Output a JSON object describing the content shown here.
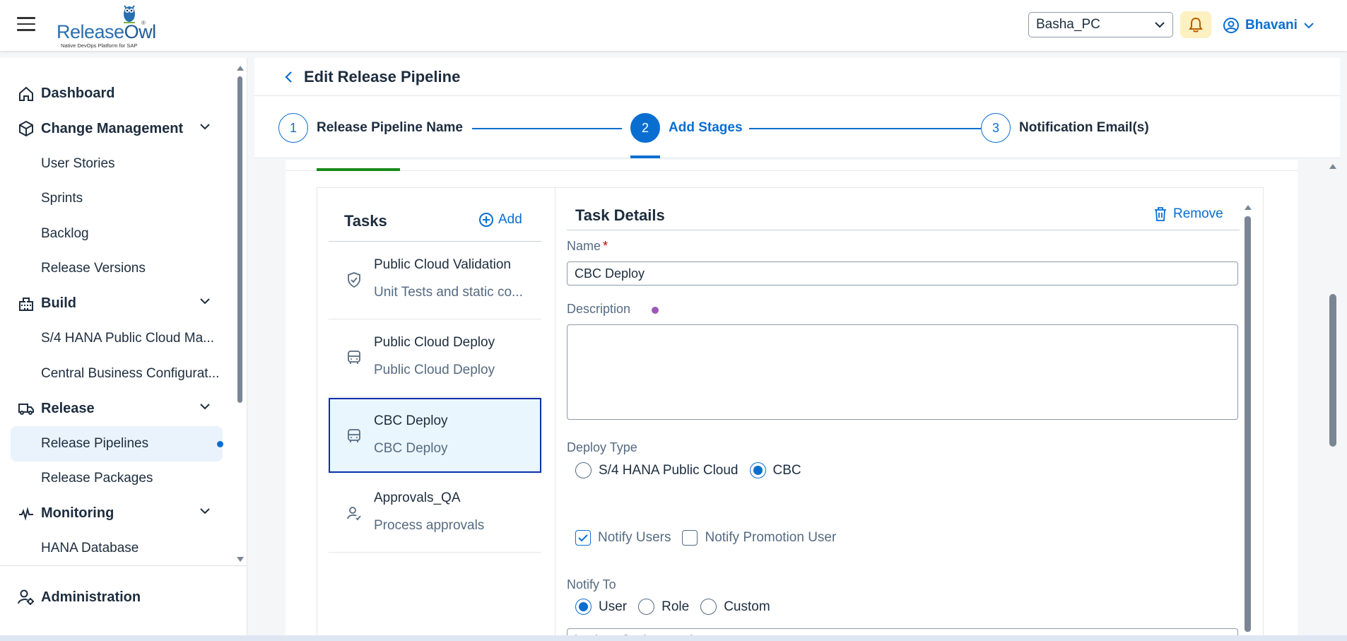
{
  "header": {
    "logo_text_a": "Release",
    "logo_text_b": "Owl",
    "logo_tm": "®",
    "logo_tagline": "Native DevOps Platform for SAP",
    "system_select": "Basha_PC",
    "user_name": "Bhavani"
  },
  "sidebar": {
    "items": [
      {
        "label": "Dashboard",
        "type": "group",
        "icon": "home-icon"
      },
      {
        "label": "Change Management",
        "type": "group",
        "icon": "cube-icon",
        "expanded": true
      },
      {
        "label": "User Stories",
        "type": "sub"
      },
      {
        "label": "Sprints",
        "type": "sub"
      },
      {
        "label": "Backlog",
        "type": "sub"
      },
      {
        "label": "Release Versions",
        "type": "sub"
      },
      {
        "label": "Build",
        "type": "group",
        "icon": "building-icon",
        "expanded": true
      },
      {
        "label": "S/4 HANA Public Cloud Ma...",
        "type": "sub"
      },
      {
        "label": "Central Business Configurat...",
        "type": "sub"
      },
      {
        "label": "Release",
        "type": "group",
        "icon": "truck-icon",
        "expanded": true
      },
      {
        "label": "Release Pipelines",
        "type": "sub",
        "active": true
      },
      {
        "label": "Release Packages",
        "type": "sub"
      },
      {
        "label": "Monitoring",
        "type": "group",
        "icon": "heart-pulse-icon",
        "expanded": true
      },
      {
        "label": "HANA Database",
        "type": "sub"
      }
    ],
    "admin_label": "Administration"
  },
  "page": {
    "title": "Edit Release Pipeline"
  },
  "stepper": {
    "steps": [
      {
        "number": "1",
        "label": "Release Pipeline Name"
      },
      {
        "number": "2",
        "label": "Add Stages",
        "active": true
      },
      {
        "number": "3",
        "label": "Notification Email(s)"
      }
    ]
  },
  "tasks": {
    "title": "Tasks",
    "add_label": "Add",
    "items": [
      {
        "title": "Public Cloud Validation",
        "subtitle": "Unit Tests and static co...",
        "icon": "shield-check-icon"
      },
      {
        "title": "Public Cloud Deploy",
        "subtitle": "Public Cloud Deploy",
        "icon": "bus-icon"
      },
      {
        "title": "CBC Deploy",
        "subtitle": "CBC Deploy",
        "icon": "bus-icon",
        "selected": true
      },
      {
        "title": "Approvals_QA",
        "subtitle": "Process approvals",
        "icon": "user-check-icon"
      }
    ]
  },
  "details": {
    "title": "Task Details",
    "remove_label": "Remove",
    "name_label": "Name",
    "name_required": "*",
    "name_value": "CBC Deploy",
    "description_label": "Description",
    "description_value": "",
    "deploy_type_label": "Deploy Type",
    "deploy_type_options": [
      "S/4 HANA Public Cloud",
      "CBC"
    ],
    "deploy_type_selected": "CBC",
    "notify_users_label": "Notify Users",
    "notify_users_checked": true,
    "notify_promotion_label": "Notify Promotion User",
    "notify_promotion_checked": false,
    "notify_to_label": "Notify To",
    "notify_to_options": [
      "User",
      "Role",
      "Custom"
    ],
    "notify_to_selected": "User",
    "recipient_value": "basha.s@releaseowl.com"
  },
  "colors": {
    "accent": "#0a6ed1",
    "tab_indicator": "#188918",
    "bell_bg": "#fdf0c1",
    "selected_task_bg": "#eaf6fd"
  }
}
